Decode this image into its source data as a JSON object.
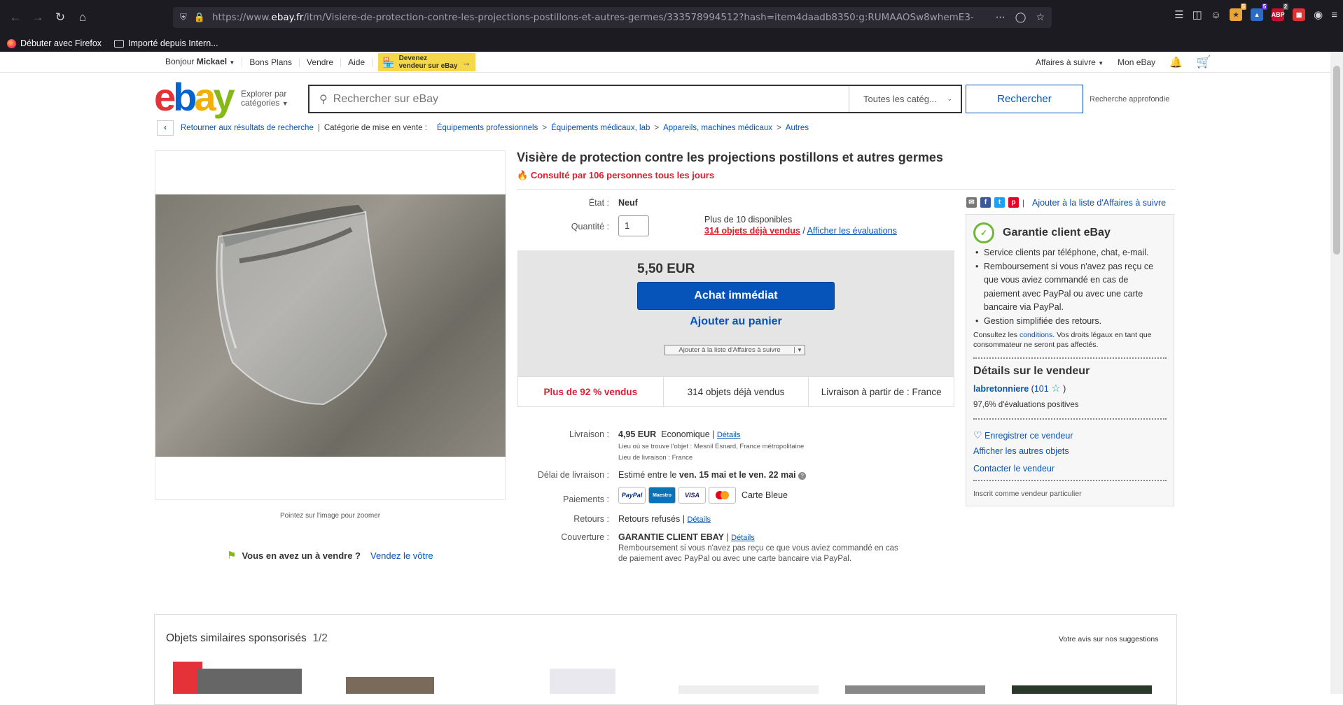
{
  "browser": {
    "url_prefix": "https://www.",
    "url_host": "ebay.fr",
    "url_path": "/itm/Visiere-de-protection-contre-les-projections-postillons-et-autres-germes/333578994512?hash=item4daadb8350:g:RUMAAOSw8whemE3-",
    "bookmarks": [
      "Débuter avec Firefox",
      "Importé depuis Intern..."
    ],
    "ext_badges": [
      "5",
      "5",
      "2"
    ],
    "ext_abp": "ABP"
  },
  "topbar": {
    "greeting": "Bonjour",
    "user": "Mickael",
    "links": [
      "Bons Plans",
      "Vendre",
      "Aide"
    ],
    "promo_line1": "Devenez",
    "promo_line2": "vendeur sur eBay",
    "affaires": "Affaires à suivre",
    "mon_ebay": "Mon eBay"
  },
  "header": {
    "logo": [
      "e",
      "b",
      "a",
      "y"
    ],
    "explore_1": "Explorer par",
    "explore_2": "catégories",
    "search_placeholder": "Rechercher sur eBay",
    "category": "Toutes les catég...",
    "search_button": "Rechercher",
    "advanced": "Recherche approfondie"
  },
  "breadcrumb": {
    "back": "Retourner aux résultats de recherche",
    "category_label": "Catégorie de mise en vente :",
    "items": [
      "Équipements professionnels",
      "Équipements médicaux, lab",
      "Appareils, machines médicaux",
      "Autres"
    ]
  },
  "gallery": {
    "zoom_hint": "Pointez sur l'image pour zoomer",
    "sell_q": "Vous en avez un à vendre ?",
    "sell_link": "Vendez le vôtre"
  },
  "item": {
    "title": "Visière de protection contre les projections postillons et autres germes",
    "viewed": "Consulté par 106 personnes tous les jours",
    "etat_label": "État :",
    "etat": "Neuf",
    "qty_label": "Quantité :",
    "qty": "1",
    "available": "Plus de 10 disponibles",
    "sold_link": "314 objets déjà vendus",
    "eval_link": "Afficher les évaluations",
    "price": "5,50 EUR",
    "buy_now": "Achat immédiat",
    "add_cart": "Ajouter au panier",
    "add_watch": "Ajouter à la liste d'Affaires à suivre",
    "stats": [
      "Plus de 92 % vendus",
      "314 objets déjà vendus",
      "Livraison à partir de : France"
    ]
  },
  "details": {
    "livraison_label": "Livraison :",
    "livraison_price": "4,95 EUR",
    "livraison_type": "Economique |",
    "details_link": "Détails",
    "lieu_objet": "Lieu où se trouve l'objet : Mesnil Esnard, France métropolitaine",
    "lieu_livraison": "Lieu de livraison : France",
    "delai_label": "Délai de livraison :",
    "delai_prefix": "Estimé entre le",
    "delai_1": "ven. 15 mai",
    "delai_mid": "et le",
    "delai_2": "ven. 22 mai",
    "paiements_label": "Paiements :",
    "cards": [
      "PayPal",
      "Maestro",
      "VISA",
      "MC"
    ],
    "carte_bleue": "Carte Bleue",
    "retours_label": "Retours :",
    "retours": "Retours refusés |",
    "couverture_label": "Couverture :",
    "couverture_title": "GARANTIE CLIENT EBAY",
    "couverture_text": "Remboursement si vous n'avez pas reçu ce que vous aviez commandé en cas de paiement avec PayPal ou avec une carte bancaire via PayPal."
  },
  "guarantee": {
    "add_watch": "Ajouter à la liste d'Affaires à suivre",
    "title": "Garantie client eBay",
    "items": [
      "Service clients par téléphone, chat, e-mail.",
      "Remboursement si vous n'avez pas reçu ce que vous aviez commandé en cas de paiement avec PayPal ou avec une carte bancaire via PayPal.",
      "Gestion simplifiée des retours."
    ],
    "consult_pre": "Consultez les",
    "consult_link": "conditions",
    "consult_post": ". Vos droits légaux en tant que consommateur ne seront pas affectés."
  },
  "vendor": {
    "title": "Détails sur le vendeur",
    "name": "labretonniere",
    "score": "101",
    "positive": "97,6% d'évaluations positives",
    "save": "Enregistrer ce vendeur",
    "other": "Afficher les autres objets",
    "contact": "Contacter le vendeur",
    "registered": "Inscrit comme vendeur particulier"
  },
  "sponsored": {
    "title": "Objets similaires sponsorisés",
    "page": "1/2",
    "feedback": "Votre avis sur nos suggestions"
  }
}
